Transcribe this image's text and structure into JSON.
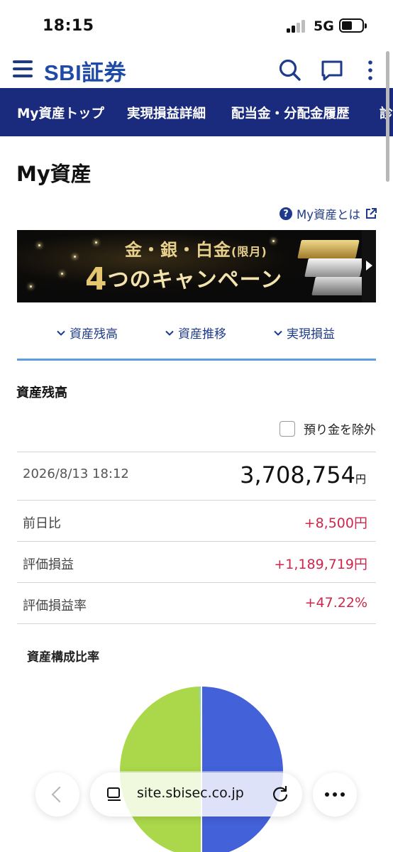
{
  "status_bar": {
    "time": "18:15",
    "network": "5G"
  },
  "header": {
    "logo": "SBI証券"
  },
  "nav": {
    "tabs": [
      "My資産トップ",
      "実現損益詳細",
      "配当金・分配金履歴",
      "診"
    ]
  },
  "page": {
    "title": "My資産",
    "help_link": "My資産とは"
  },
  "banner": {
    "line1_main": "金・銀・白金",
    "line1_sub": "(限月)",
    "line2_num": "4",
    "line2_text": "つのキャンペーン"
  },
  "anchors": [
    "資産残高",
    "資産推移",
    "実現損益"
  ],
  "balance": {
    "section_title": "資産残高",
    "exclude_label": "預り金を除外",
    "exclude_checked": false,
    "datetime": "2026/8/13 18:12",
    "total": "3,708,754",
    "unit": "円",
    "metrics": [
      {
        "label": "前日比",
        "value": "+8,500円"
      },
      {
        "label": "評価損益",
        "value": "+1,189,719円"
      },
      {
        "label": "評価損益率",
        "value": "+47.22%"
      }
    ]
  },
  "composition": {
    "title": "資産構成比率",
    "colors": {
      "blue": "#4361d8",
      "green": "#aad84a",
      "teal": "#7fd3c3"
    }
  },
  "browser": {
    "url": "site.sbisec.co.jp"
  },
  "colors": {
    "nav_bg": "#1a2a7c",
    "accent_blue": "#1e3a8a",
    "positive": "#d0264b",
    "divider": "#5b9ee2"
  }
}
